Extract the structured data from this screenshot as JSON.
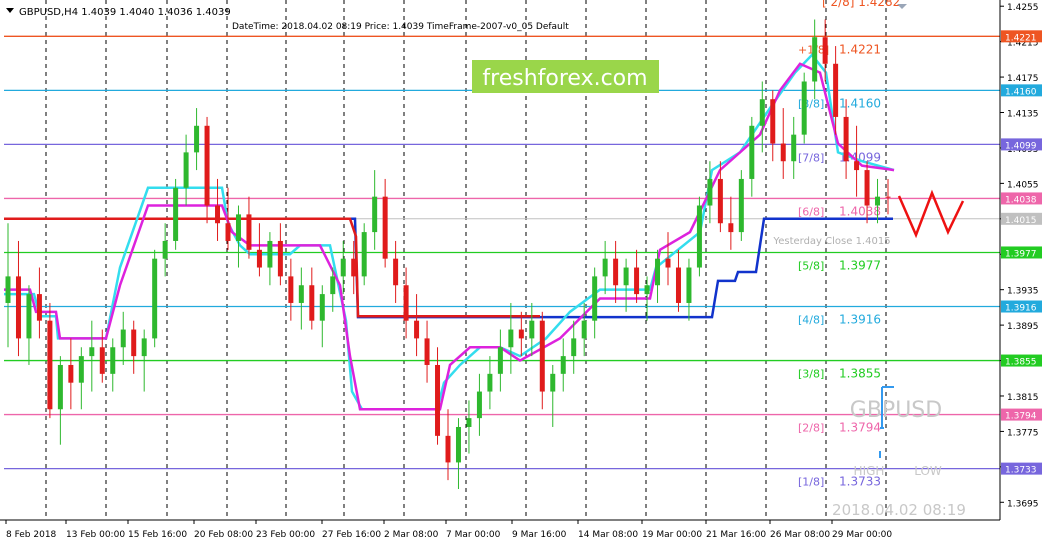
{
  "header": {
    "symbol_line": "GBPUSD,H4  1.4039 1.4040 1.4036 1.4039",
    "info_line": "DateTime: 2018.04.02 08:19    Price: 1.4039    TimeFrame-2007-v0_05    Default"
  },
  "watermark": {
    "brand": "freshforex.com",
    "symbol": "GBPUSD",
    "high_label": "HIGH",
    "low_label": "LOW",
    "datetime": "2018.04.02 08:19",
    "yesterday_close": "Yesterday Close 1.4015"
  },
  "colors": {
    "bull": "#2eb82e",
    "bear": "#e01b1b",
    "cyan_line": "#33ddee",
    "magenta_line": "#dd22dd",
    "blue_step": "#1133cc",
    "red_step": "#e01b1b",
    "brand_bg": "#9ad64a",
    "grid": "#000000"
  },
  "chart_data": {
    "type": "candlestick",
    "symbol": "GBPUSD",
    "timeframe": "H4",
    "ylim": [
      1.3675,
      1.4262
    ],
    "y_ticks": [
      "1.4255",
      "1.4215",
      "1.4175",
      "1.4135",
      "1.4095",
      "1.4055",
      "1.4015",
      "1.3975",
      "1.3935",
      "1.3895",
      "1.3855",
      "1.3815",
      "1.3775",
      "1.3735",
      "1.3695"
    ],
    "x_ticks": [
      "8 Feb 2018",
      "13 Feb 00:00",
      "15 Feb 16:00",
      "20 Feb 08:00",
      "23 Feb 00:00",
      "27 Feb 16:00",
      "2 Mar 08:00",
      "7 Mar 00:00",
      "9 Mar 16:00",
      "14 Mar 08:00",
      "19 Mar 00:00",
      "21 Mar 16:00",
      "26 Mar 08:00",
      "29 Mar 00:00"
    ],
    "levels": [
      {
        "name": "[8/8]",
        "value": 1.4282,
        "price_tag": "",
        "label": "[ 2/8]  1.4282",
        "color": "#ee5522"
      },
      {
        "name": "[+1/8]",
        "value": 1.4221,
        "price_tag": "1.4221",
        "label": "+1/8]",
        "value_text": "1.4221",
        "color": "#ee5522"
      },
      {
        "name": "[8/8]",
        "value": 1.416,
        "price_tag": "1.4160",
        "label": "[8/8]",
        "value_text": "1.4160",
        "color": "#22aadd"
      },
      {
        "name": "[7/8]",
        "value": 1.4099,
        "price_tag": "1.4099",
        "label": "[7/8]",
        "value_text": "1.4099",
        "color": "#7766dd"
      },
      {
        "name": "[6/8]",
        "value": 1.4038,
        "price_tag": "1.4038",
        "label": "[6/8]",
        "value_text": "1.4038",
        "color": "#ee66aa"
      },
      {
        "name": "[5/8]",
        "value": 1.3977,
        "price_tag": "1.3977",
        "label": "[5/8]",
        "value_text": "1.3977",
        "color": "#22cc22"
      },
      {
        "name": "[4/8]",
        "value": 1.3916,
        "price_tag": "1.3916",
        "label": "[4/8]",
        "value_text": "1.3916",
        "color": "#22aadd"
      },
      {
        "name": "[3/8]",
        "value": 1.3855,
        "price_tag": "1.3855",
        "label": "[3/8]",
        "value_text": "1.3855",
        "color": "#22cc22"
      },
      {
        "name": "[2/8]",
        "value": 1.3794,
        "price_tag": "1.3794",
        "label": "[2/8]",
        "value_text": "1.3794",
        "color": "#ee66aa"
      },
      {
        "name": "[1/8]",
        "value": 1.3733,
        "price_tag": "1.3733",
        "label": "[1/8]",
        "value_text": "1.3733",
        "color": "#7766dd"
      }
    ],
    "current_price": {
      "value": 1.4015,
      "tag": "1.4015"
    },
    "candles": [
      [
        1.392,
        1.401,
        1.387,
        1.395
      ],
      [
        1.395,
        1.399,
        1.386,
        1.388
      ],
      [
        1.388,
        1.394,
        1.385,
        1.393
      ],
      [
        1.393,
        1.396,
        1.388,
        1.39
      ],
      [
        1.39,
        1.392,
        1.379,
        1.38
      ],
      [
        1.38,
        1.386,
        1.376,
        1.385
      ],
      [
        1.385,
        1.388,
        1.38,
        1.383
      ],
      [
        1.383,
        1.387,
        1.38,
        1.386
      ],
      [
        1.386,
        1.39,
        1.382,
        1.387
      ],
      [
        1.387,
        1.389,
        1.383,
        1.384
      ],
      [
        1.384,
        1.388,
        1.382,
        1.387
      ],
      [
        1.387,
        1.391,
        1.385,
        1.389
      ],
      [
        1.389,
        1.39,
        1.384,
        1.386
      ],
      [
        1.386,
        1.389,
        1.382,
        1.388
      ],
      [
        1.388,
        1.398,
        1.387,
        1.397
      ],
      [
        1.397,
        1.401,
        1.395,
        1.399
      ],
      [
        1.399,
        1.406,
        1.398,
        1.405
      ],
      [
        1.405,
        1.411,
        1.403,
        1.409
      ],
      [
        1.409,
        1.414,
        1.407,
        1.412
      ],
      [
        1.412,
        1.413,
        1.401,
        1.403
      ],
      [
        1.403,
        1.406,
        1.399,
        1.401
      ],
      [
        1.401,
        1.405,
        1.398,
        1.399
      ],
      [
        1.399,
        1.403,
        1.396,
        1.402
      ],
      [
        1.402,
        1.404,
        1.397,
        1.398
      ],
      [
        1.398,
        1.401,
        1.395,
        1.396
      ],
      [
        1.396,
        1.4,
        1.394,
        1.399
      ],
      [
        1.399,
        1.401,
        1.394,
        1.395
      ],
      [
        1.395,
        1.397,
        1.39,
        1.392
      ],
      [
        1.392,
        1.396,
        1.389,
        1.394
      ],
      [
        1.394,
        1.396,
        1.389,
        1.39
      ],
      [
        1.39,
        1.394,
        1.387,
        1.393
      ],
      [
        1.393,
        1.396,
        1.391,
        1.395
      ],
      [
        1.395,
        1.399,
        1.393,
        1.397
      ],
      [
        1.397,
        1.399,
        1.393,
        1.395
      ],
      [
        1.395,
        1.401,
        1.394,
        1.4
      ],
      [
        1.4,
        1.407,
        1.398,
        1.404
      ],
      [
        1.404,
        1.406,
        1.396,
        1.397
      ],
      [
        1.397,
        1.399,
        1.392,
        1.394
      ],
      [
        1.394,
        1.396,
        1.388,
        1.39
      ],
      [
        1.39,
        1.393,
        1.386,
        1.388
      ],
      [
        1.388,
        1.39,
        1.383,
        1.385
      ],
      [
        1.385,
        1.387,
        1.376,
        1.377
      ],
      [
        1.377,
        1.38,
        1.372,
        1.374
      ],
      [
        1.374,
        1.379,
        1.371,
        1.378
      ],
      [
        1.378,
        1.381,
        1.375,
        1.379
      ],
      [
        1.379,
        1.384,
        1.377,
        1.382
      ],
      [
        1.382,
        1.386,
        1.38,
        1.384
      ],
      [
        1.384,
        1.389,
        1.382,
        1.387
      ],
      [
        1.387,
        1.392,
        1.384,
        1.389
      ],
      [
        1.389,
        1.391,
        1.386,
        1.388
      ],
      [
        1.388,
        1.392,
        1.386,
        1.39
      ],
      [
        1.39,
        1.391,
        1.38,
        1.382
      ],
      [
        1.382,
        1.385,
        1.378,
        1.384
      ],
      [
        1.384,
        1.388,
        1.382,
        1.386
      ],
      [
        1.386,
        1.39,
        1.384,
        1.388
      ],
      [
        1.388,
        1.392,
        1.386,
        1.39
      ],
      [
        1.39,
        1.396,
        1.388,
        1.395
      ],
      [
        1.395,
        1.399,
        1.393,
        1.397
      ],
      [
        1.397,
        1.399,
        1.392,
        1.394
      ],
      [
        1.394,
        1.397,
        1.391,
        1.396
      ],
      [
        1.396,
        1.398,
        1.392,
        1.393
      ],
      [
        1.393,
        1.395,
        1.39,
        1.394
      ],
      [
        1.394,
        1.398,
        1.392,
        1.397
      ],
      [
        1.397,
        1.4,
        1.394,
        1.396
      ],
      [
        1.396,
        1.398,
        1.391,
        1.392
      ],
      [
        1.392,
        1.397,
        1.39,
        1.396
      ],
      [
        1.396,
        1.404,
        1.395,
        1.403
      ],
      [
        1.403,
        1.408,
        1.401,
        1.406
      ],
      [
        1.406,
        1.408,
        1.4,
        1.401
      ],
      [
        1.401,
        1.404,
        1.398,
        1.4
      ],
      [
        1.4,
        1.407,
        1.399,
        1.406
      ],
      [
        1.406,
        1.413,
        1.404,
        1.412
      ],
      [
        1.412,
        1.417,
        1.409,
        1.415
      ],
      [
        1.415,
        1.416,
        1.408,
        1.41
      ],
      [
        1.41,
        1.414,
        1.406,
        1.408
      ],
      [
        1.408,
        1.413,
        1.406,
        1.411
      ],
      [
        1.411,
        1.418,
        1.41,
        1.417
      ],
      [
        1.417,
        1.424,
        1.415,
        1.422
      ],
      [
        1.422,
        1.424,
        1.417,
        1.419
      ],
      [
        1.419,
        1.421,
        1.411,
        1.413
      ],
      [
        1.413,
        1.415,
        1.406,
        1.408
      ],
      [
        1.408,
        1.412,
        1.404,
        1.407
      ],
      [
        1.407,
        1.408,
        1.401,
        1.403
      ],
      [
        1.403,
        1.406,
        1.401,
        1.404
      ],
      [
        1.404,
        1.406,
        1.402,
        1.4039
      ]
    ]
  }
}
